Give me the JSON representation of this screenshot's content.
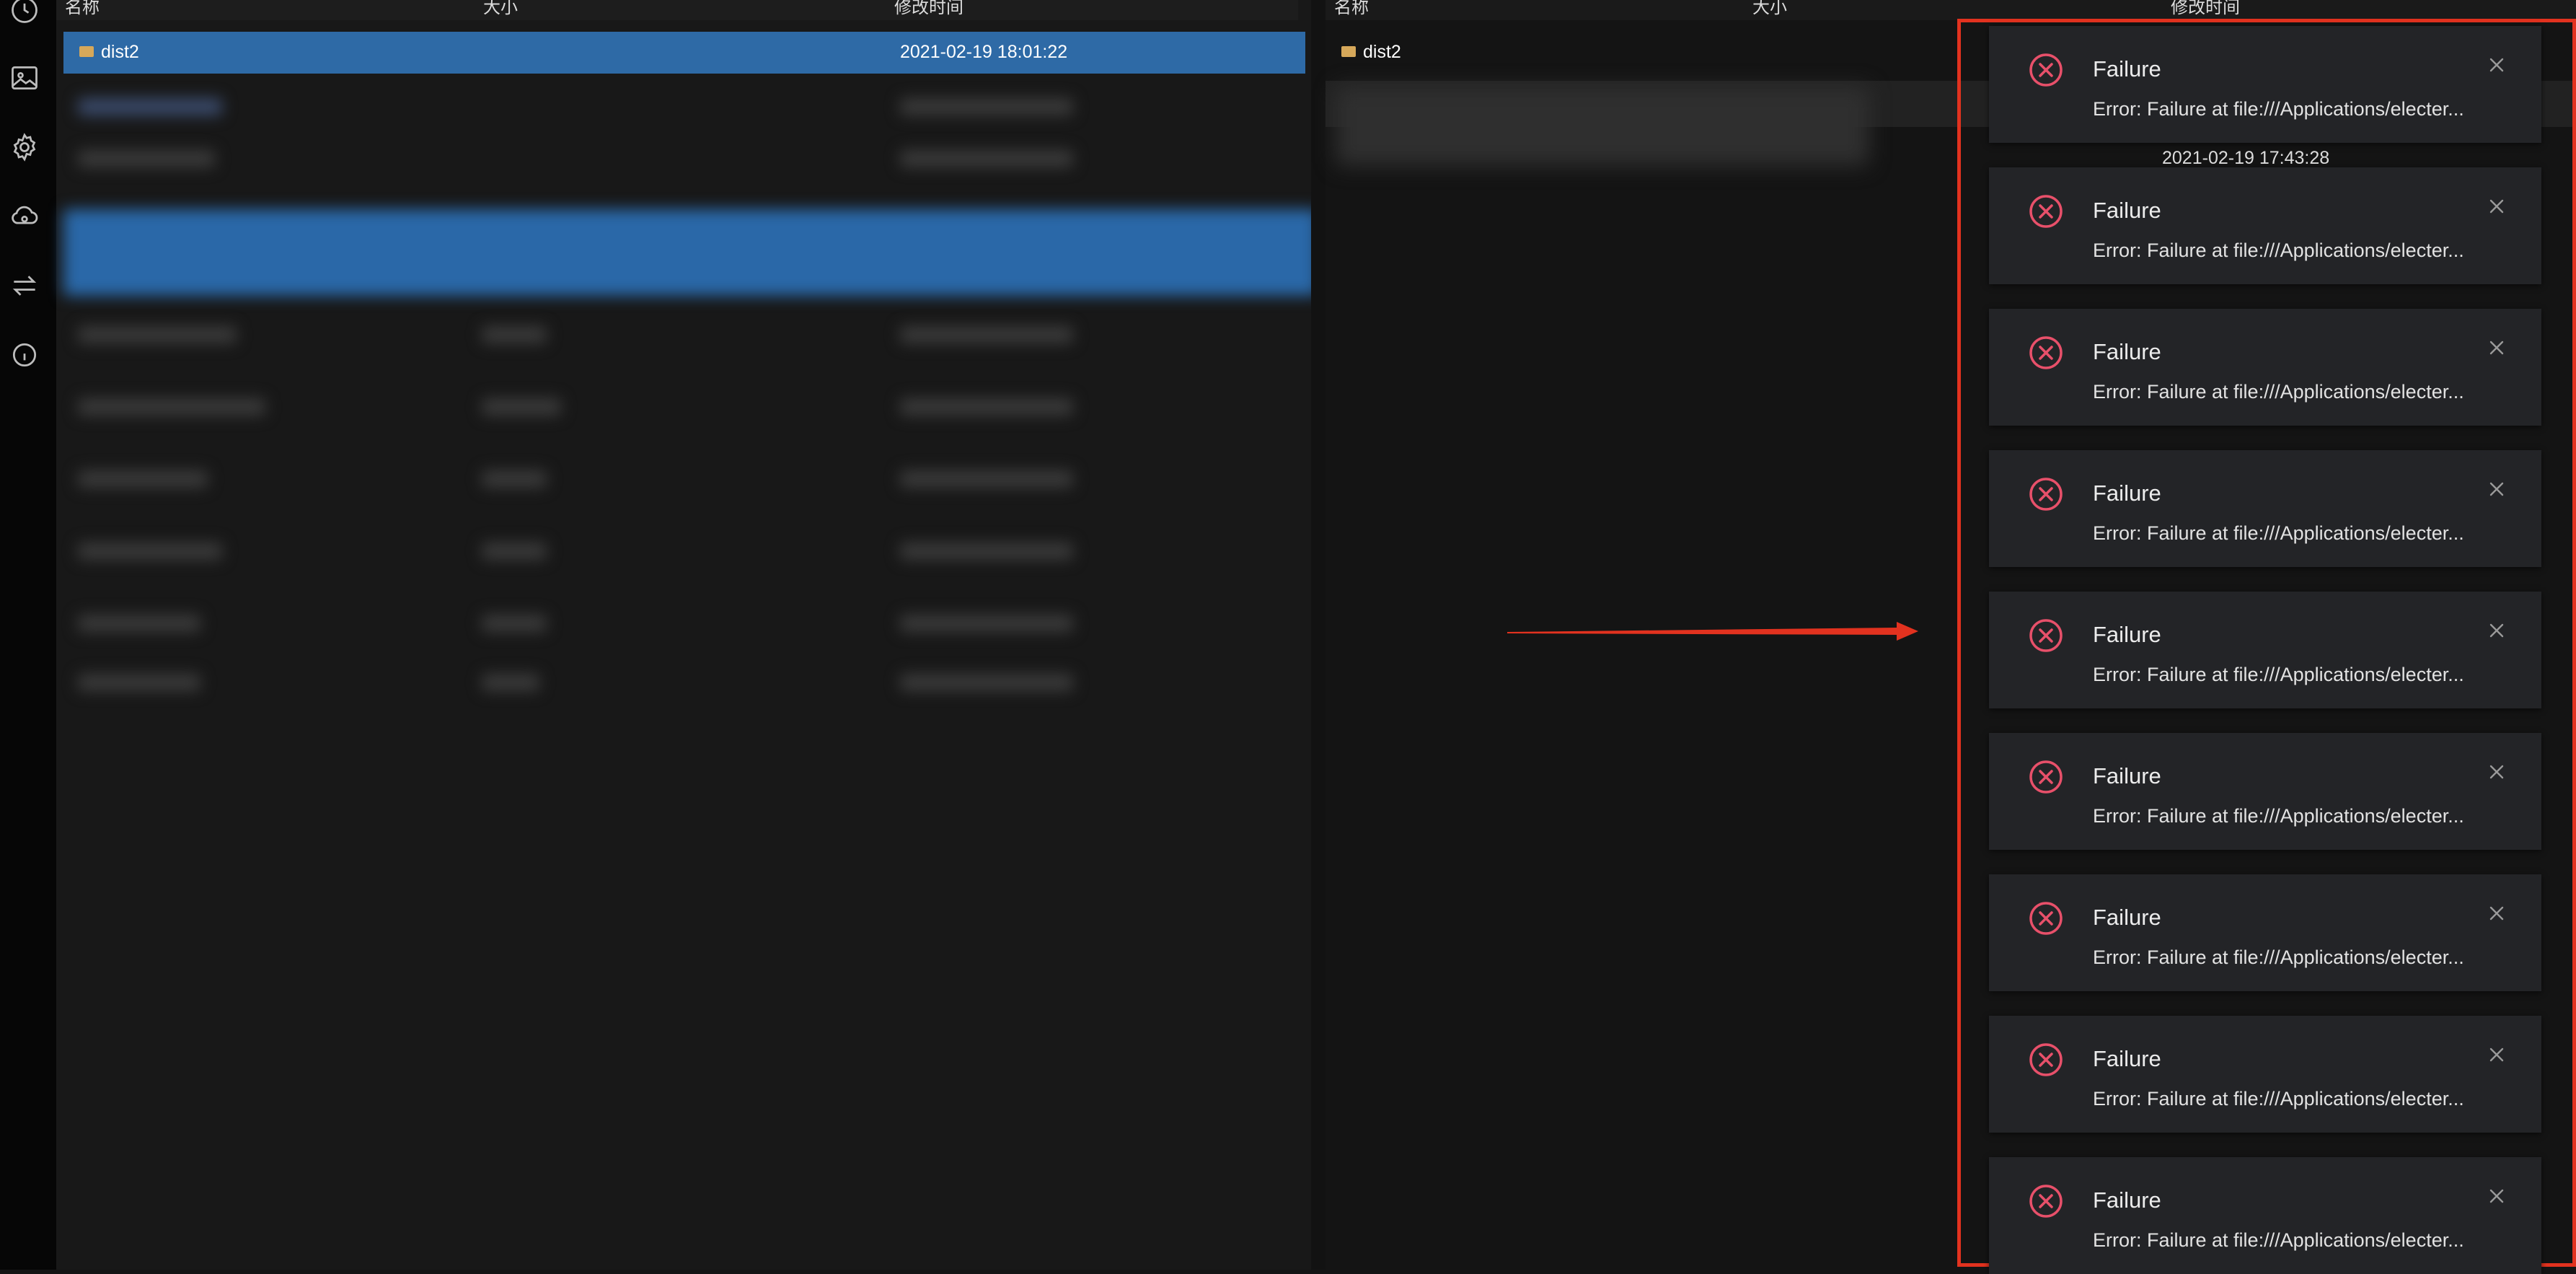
{
  "left_panel": {
    "columns": {
      "name": "名称",
      "size": "大小",
      "modified": "修改时间"
    },
    "selected_row": {
      "name": "dist2",
      "modified": "2021-02-19 18:01:22"
    }
  },
  "right_panel": {
    "columns": {
      "name": "名称",
      "size": "大小",
      "modified": "修改时间"
    },
    "row": {
      "name": "dist2"
    }
  },
  "notifications": {
    "timestamp": "2021-02-19 17:43:28",
    "items": [
      {
        "title": "Failure",
        "message": "Error: Failure at file:///Applications/electer..."
      },
      {
        "title": "Failure",
        "message": "Error: Failure at file:///Applications/electer..."
      },
      {
        "title": "Failure",
        "message": "Error: Failure at file:///Applications/electer..."
      },
      {
        "title": "Failure",
        "message": "Error: Failure at file:///Applications/electer..."
      },
      {
        "title": "Failure",
        "message": "Error: Failure at file:///Applications/electer..."
      },
      {
        "title": "Failure",
        "message": "Error: Failure at file:///Applications/electer..."
      },
      {
        "title": "Failure",
        "message": "Error: Failure at file:///Applications/electer..."
      },
      {
        "title": "Failure",
        "message": "Error: Failure at file:///Applications/electer..."
      },
      {
        "title": "Failure",
        "message": "Error: Failure at file:///Applications/electer..."
      }
    ]
  },
  "sidebar_icons": [
    "history-icon",
    "image-icon",
    "settings-icon",
    "cloud-icon",
    "transfer-icon",
    "info-icon"
  ],
  "colors": {
    "selection": "#2e6aa6",
    "error": "#e8506a",
    "annotation": "#e2321f",
    "toast_bg": "#232427"
  }
}
